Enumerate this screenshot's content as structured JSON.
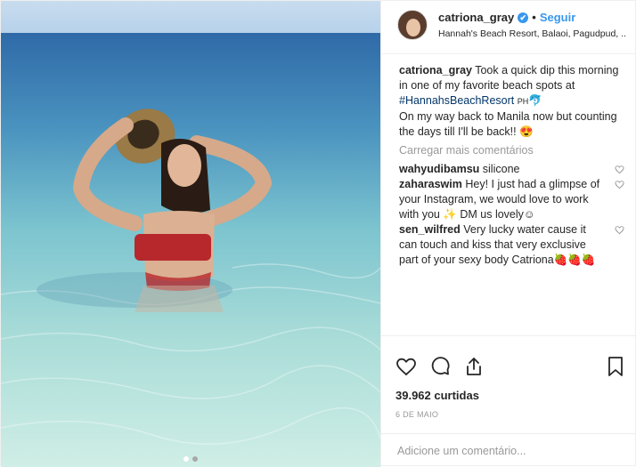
{
  "header": {
    "username": "catriona_gray",
    "verified_mark": "✔",
    "separator": "•",
    "follow_label": "Seguir",
    "location": "Hannah's Beach Resort, Balaoi, Pagudpud, ..."
  },
  "caption": {
    "username": "catriona_gray",
    "text_1": "Took a quick dip this morning in one of my favorite beach spots at",
    "hashtag": "#HannahsBeachResort",
    "flag": "PH",
    "emoji_1": "🐬",
    "text_2": "On my way back to Manila now but counting the days till I'll be back!!",
    "emoji_2": "😍"
  },
  "load_more": "Carregar mais comentários",
  "comments": [
    {
      "username": "wahyudibamsu",
      "text": "silicone"
    },
    {
      "username": "zaharaswim",
      "text": "Hey! I just had a glimpse of your Instagram, we would love to work with you ✨ DM us lovely☺"
    },
    {
      "username": "sen_wilfred",
      "text": "Very lucky water cause it can touch and kiss that very exclusive part of your sexy body Catriona🍓🍓🍓"
    }
  ],
  "likes": "39.962 curtidas",
  "date": "6 DE MAIO",
  "add_comment_placeholder": "Adicione um comentário...",
  "icons": [
    "heart-icon",
    "comment-icon",
    "share-icon",
    "bookmark-icon",
    "verified-icon"
  ],
  "colors": {
    "link": "#3897f0",
    "muted": "#999999",
    "hashtag": "#003569"
  }
}
